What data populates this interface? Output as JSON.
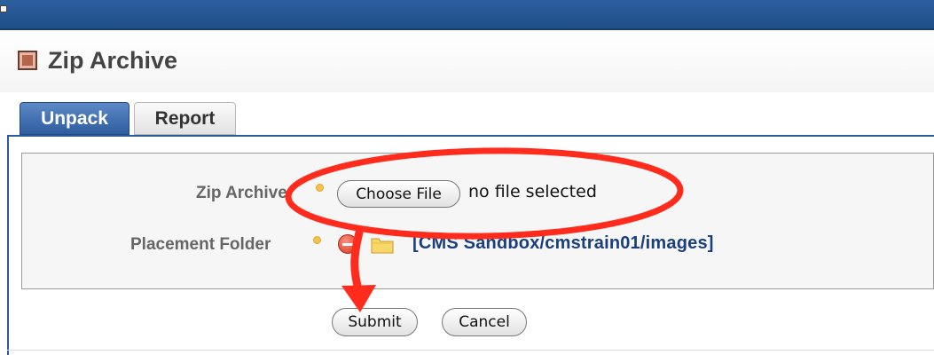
{
  "page": {
    "title": "Zip Archive"
  },
  "tabs": [
    {
      "label": "Unpack",
      "active": true
    },
    {
      "label": "Report",
      "active": false
    }
  ],
  "form": {
    "zip_archive_label": "Zip Archive",
    "choose_file_label": "Choose File",
    "file_status": "no file selected",
    "placement_folder_label": "Placement Folder",
    "placement_folder_value": "[CMS Sandbox/cmstrain01/images]"
  },
  "buttons": {
    "submit": "Submit",
    "cancel": "Cancel"
  },
  "colors": {
    "header_bar": "#1f4e89",
    "active_tab": "#2f5c9e",
    "folder_link": "#1b3f7c",
    "annotation": "#ff2b1c",
    "required_marker": "#f3c24e"
  },
  "icons": {
    "title": "archive-icon",
    "remove": "remove-icon",
    "folder": "folder-icon"
  }
}
